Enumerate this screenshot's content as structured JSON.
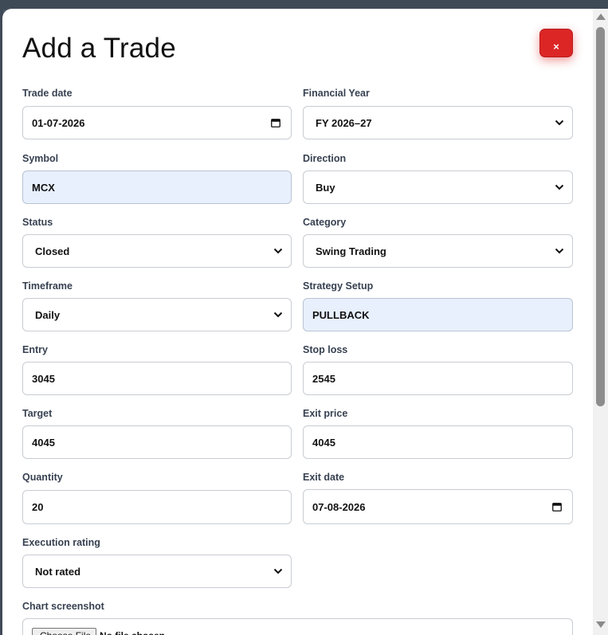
{
  "modal": {
    "title": "Add a Trade",
    "close_label": "×"
  },
  "fields": {
    "trade_date": {
      "label": "Trade date",
      "value": "01-07-2026"
    },
    "financial_year": {
      "label": "Financial Year",
      "value": "FY 2026–27"
    },
    "symbol": {
      "label": "Symbol",
      "value": "MCX"
    },
    "direction": {
      "label": "Direction",
      "value": "Buy"
    },
    "status": {
      "label": "Status",
      "value": "Closed"
    },
    "category": {
      "label": "Category",
      "value": "Swing Trading"
    },
    "timeframe": {
      "label": "Timeframe",
      "value": "Daily"
    },
    "strategy_setup": {
      "label": "Strategy Setup",
      "value": "PULLBACK"
    },
    "entry": {
      "label": "Entry",
      "value": "3045"
    },
    "stop_loss": {
      "label": "Stop loss",
      "value": "2545"
    },
    "target": {
      "label": "Target",
      "value": "4045"
    },
    "exit_price": {
      "label": "Exit price",
      "value": "4045"
    },
    "quantity": {
      "label": "Quantity",
      "value": "20"
    },
    "exit_date": {
      "label": "Exit date",
      "value": "07-08-2026"
    },
    "execution_rating": {
      "label": "Execution rating",
      "value": "Not rated"
    },
    "chart_screenshot": {
      "label": "Chart screenshot",
      "button_label": "Choose File",
      "file_status": "No file chosen"
    }
  },
  "icons": {
    "chevron": "chevron-down-icon",
    "calendar": "calendar-icon",
    "close": "close-icon"
  },
  "colors": {
    "close_button": "#dc2626",
    "autofill_bg": "#e8f0fe"
  }
}
